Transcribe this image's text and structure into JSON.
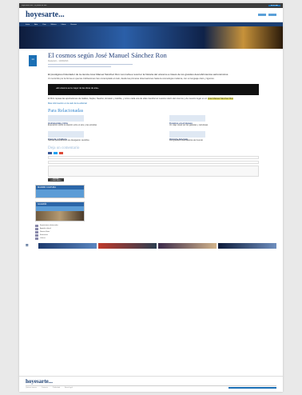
{
  "topbar": {
    "left": "hoyesarte.com · el portal de arte",
    "right": "BUSCAR"
  },
  "brand": {
    "logo": "hoyesarte..."
  },
  "nav": [
    "Inicio",
    "Arte",
    "Cine",
    "Música",
    "Libros",
    "Escena"
  ],
  "article": {
    "title": "El cosmos según José Manuel Sánchez Ron",
    "meta": "Redacción · 12/09/2013",
    "share_count": "14",
    "lead": "El prestigioso historiador de la ciencia José Manuel Sánchez Ron nos invita a recorrer la historia del universo a través de los grandes descubrimientos astronómicos.",
    "para1": "Un recorrido por la forma en que las civilizaciones han contemplado el cielo, desde las primeras observaciones hasta la cosmología moderna, con un lenguaje claro y riguroso.",
    "quote": "«El universo es la mayor de las obras de arte»",
    "para2": "El libro repasa las aportaciones de Galileo, Kepler, Newton, Einstein y Hubble, y cómo cada una de ellas transformó nuestra visión del cosmos y de nuestro lugar en él.",
    "highlight": "José Manuel Sánchez Ron",
    "link_text": "Más información en la web de la editorial"
  },
  "related": {
    "heading": "Para Relacionadas",
    "items": [
      {
        "title": "Astronomía y Arte",
        "text": "Exposición sobre la relación entre el arte y las estrellas"
      },
      {
        "title": "Cosmos en el museo",
        "text": "Un viaje visual por las galaxias y nebulosas"
      },
      {
        "title": "Ciencia y Cultura",
        "text": "Nuevas publicaciones de divulgación científica"
      },
      {
        "title": "Historia del cielo",
        "text": "Los grandes observatorios del mundo"
      }
    ]
  },
  "comments": {
    "heading": "Deja un comentario",
    "submit": "ENVIAR COMENTARIO"
  },
  "sidebar": {
    "ad1_head": "MADRID CULTURA",
    "ad2_head": "GALERÍA",
    "list_items": [
      "Exposiciones destacadas",
      "Agenda cultural",
      "Nuevos libros",
      "Entrevistas",
      "Críticas"
    ]
  },
  "footer": {
    "logo": "hoyesarte...",
    "links": [
      "Quiénes somos",
      "Contacto",
      "Publicidad",
      "Aviso legal"
    ]
  },
  "colors": {
    "brand": "#1b3f73",
    "accent": "#1a6fb5",
    "highlight": "#e9e36b"
  }
}
